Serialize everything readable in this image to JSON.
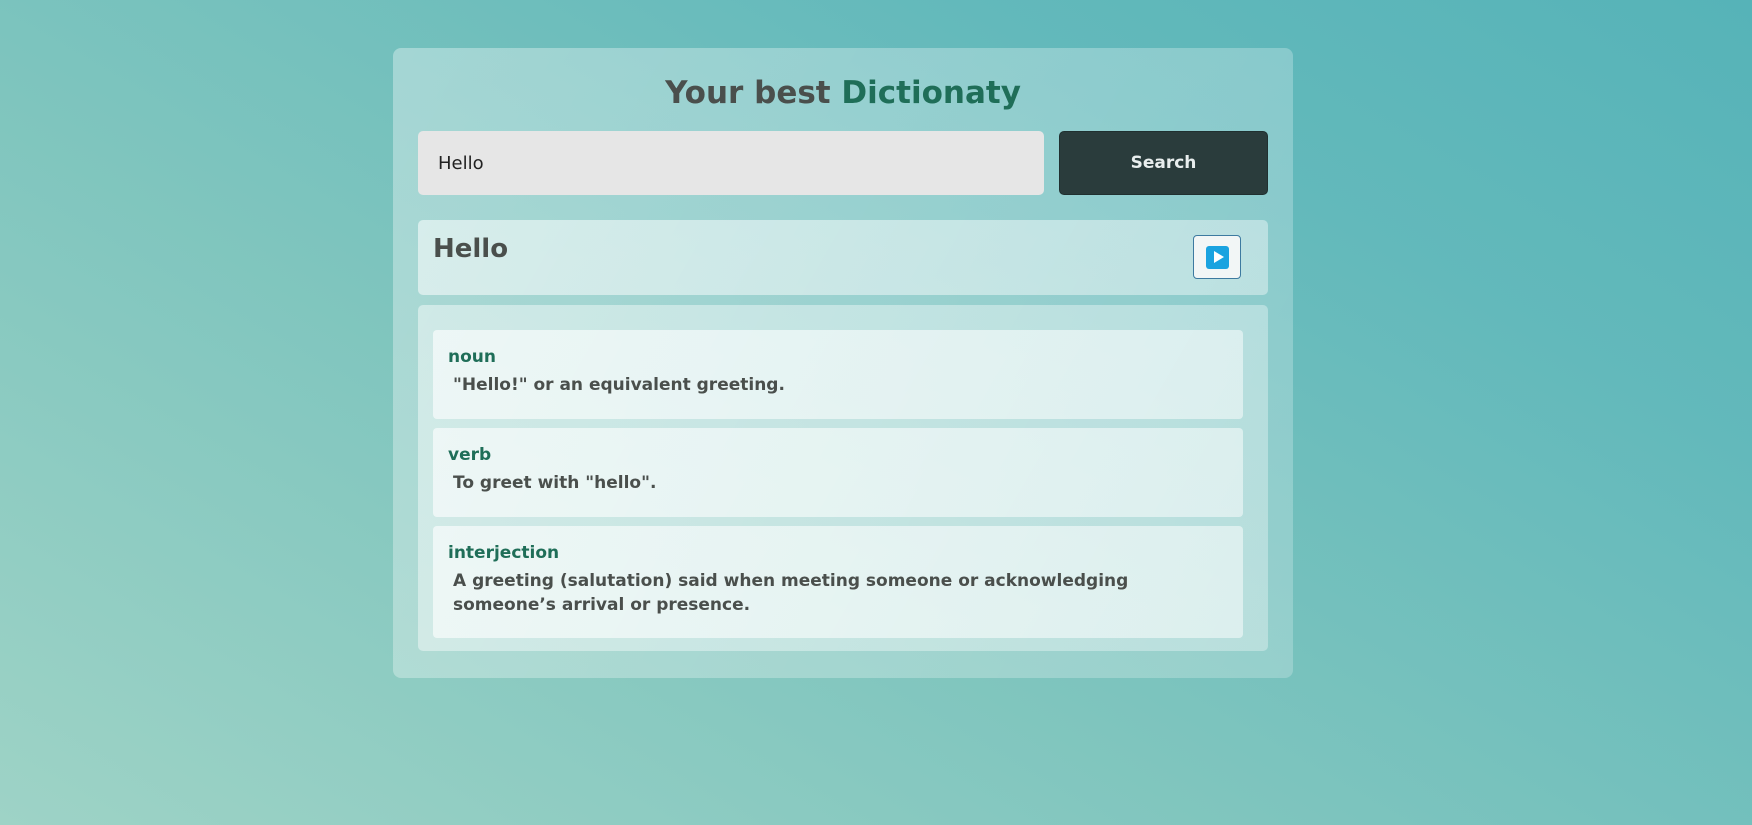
{
  "header": {
    "title_prefix": "Your best",
    "title_accent": "Dictionaty"
  },
  "search": {
    "value": "Hello",
    "button_label": "Search"
  },
  "result": {
    "word": "Hello",
    "audio_icon": "play-icon",
    "definitions": [
      {
        "part_of_speech": "noun",
        "meaning": "\"Hello!\" or an equivalent greeting."
      },
      {
        "part_of_speech": "verb",
        "meaning": "To greet with \"hello\"."
      },
      {
        "part_of_speech": "interjection",
        "meaning": "A greeting (salutation) said when meeting someone or acknowledging someone’s arrival or presence."
      }
    ]
  },
  "colors": {
    "accent": "#1f6e58",
    "button_bg": "#2a3c3c",
    "play_icon": "#1aa3e0"
  }
}
